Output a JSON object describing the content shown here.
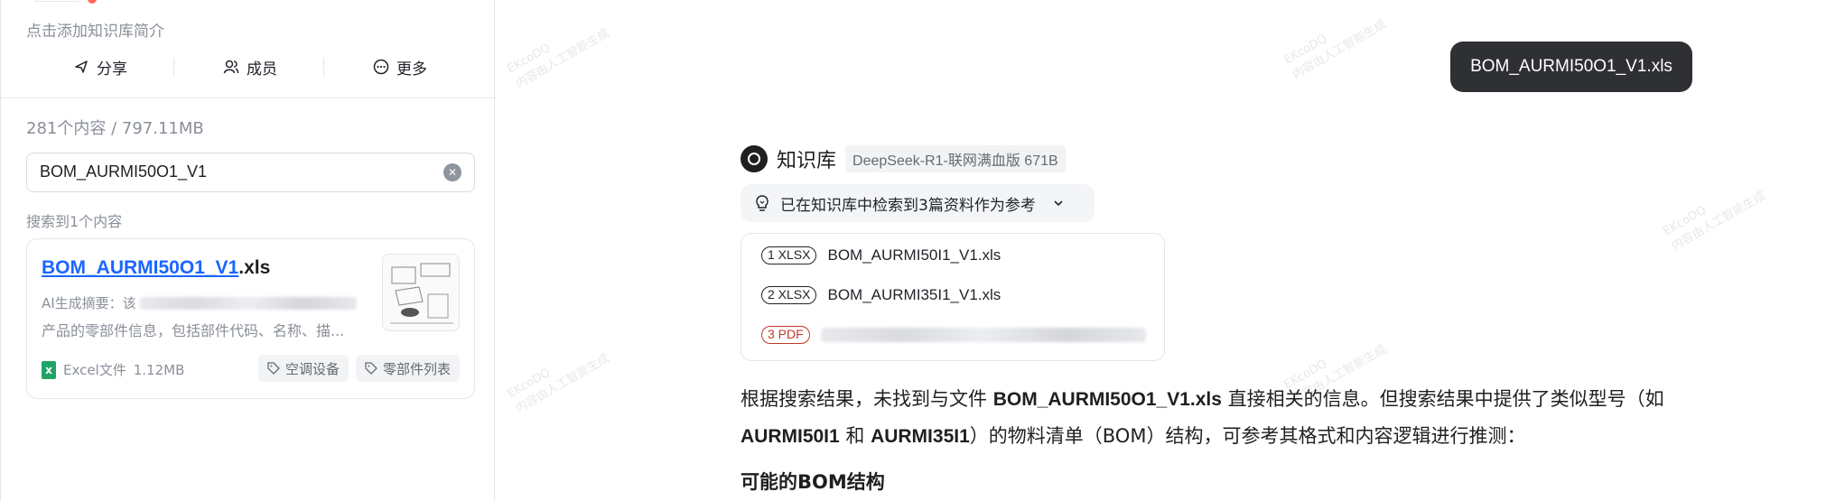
{
  "left_panel": {
    "description_placeholder": "点击添加知识库简介",
    "actions": [
      {
        "label": "分享",
        "icon": "share-icon"
      },
      {
        "label": "成员",
        "icon": "members-icon"
      },
      {
        "label": "更多",
        "icon": "more-icon"
      }
    ],
    "stats": "281个内容 / 797.11MB",
    "search": {
      "value": "BOM_AURMI50O1_V1"
    },
    "found_label": "搜索到1个内容",
    "result": {
      "title_match": "BOM_AURMI50O1_V1",
      "title_ext": ".xls",
      "summary_prefix": "AI生成摘要：该",
      "summary_line2": "产品的零部件信息，包括部件代码、名称、描...",
      "file_type": "Excel文件",
      "file_size": "1.12MB",
      "tags": [
        "空调设备",
        "零部件列表"
      ]
    }
  },
  "chat": {
    "user_message": "BOM_AURMI50O1_V1.xls",
    "assistant_name": "知识库",
    "model": "DeepSeek-R1-联网满血版 671B",
    "retrieval_text": "已在知识库中检索到3篇资料作为参考",
    "refs": [
      {
        "badge": "1 XLSX",
        "name": "BOM_AURMI50I1_V1.xls"
      },
      {
        "badge": "2 XLSX",
        "name": "BOM_AURMI35I1_V1.xls"
      },
      {
        "badge": "3 PDF",
        "name": ""
      }
    ],
    "answer": {
      "p1_a": "根据搜索结果，未找到与文件 ",
      "p1_b": "BOM_AURMI50O1_V1.xls",
      "p1_c": " 直接相关的信息。但搜索结果中提供了类似型号（如 ",
      "p1_d": "AURMI50I1",
      "p1_e": " 和 ",
      "p1_f": "AURMI35I1",
      "p1_g": "）的物料清单（BOM）结构，可参考其格式和内容逻辑进行推测：",
      "heading": "可能的BOM结构"
    },
    "watermark_line1": "EKcoDQ",
    "watermark_line2": "内容由人工智能生成"
  },
  "colors": {
    "accent": "#1a66ff",
    "bubble": "#2f3033",
    "excel": "#21a366",
    "pdf": "#c0392b"
  }
}
